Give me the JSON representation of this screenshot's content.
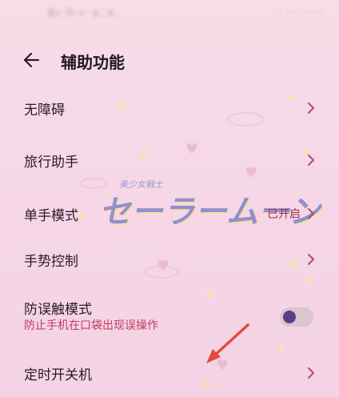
{
  "status_bar": {
    "left": "Br·Tr·r· k..k.",
    "right": "·· ··· ·····"
  },
  "header": {
    "title": "辅助功能"
  },
  "items": [
    {
      "label": "无障碍"
    },
    {
      "label": "旅行助手"
    },
    {
      "label": "单手模式",
      "value": "已开启"
    },
    {
      "label": "手势控制"
    },
    {
      "label": "防误触模式",
      "subtitle": "防止手机在口袋出现误操作",
      "toggle_state": "on"
    },
    {
      "label": "定时开关机"
    }
  ],
  "decor": {
    "watermark": "セーラームーン",
    "watermark_small": "美少女戦士"
  },
  "colors": {
    "accent": "#c23a5f",
    "toggle_knob": "#5a3f86",
    "chevron": "#b04a76",
    "annotation_arrow": "#e04b3a"
  }
}
